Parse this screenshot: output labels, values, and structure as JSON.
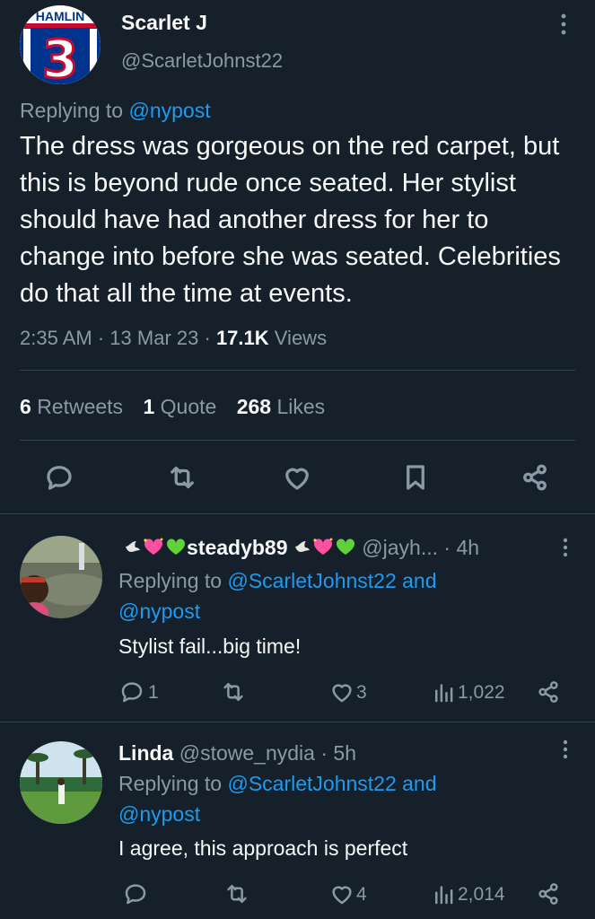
{
  "main_tweet": {
    "author_name": "Scarlet J",
    "author_handle": "@ScarletJohnst22",
    "jersey_name": "HAMLIN",
    "jersey_number": "3",
    "replying_to_prefix": "Replying to",
    "replying_to_handle": "@nypost",
    "text": "The dress was gorgeous on the red carpet, but this is beyond rude once seated. Her stylist should have had another dress for her to change into before she was seated. Celebrities do that all the time at events.",
    "time": "2:35 AM",
    "date": "13 Mar 23",
    "views_count": "17.1K",
    "views_label": "Views",
    "retweets_count": "6",
    "retweets_label": "Retweets",
    "quotes_count": "1",
    "quotes_label": "Quote",
    "likes_count": "268",
    "likes_label": "Likes",
    "actions": [
      "reply-icon",
      "retweet-icon",
      "like-icon",
      "bookmark-icon",
      "share-icon"
    ]
  },
  "replies": [
    {
      "display_name": "steadyb89",
      "handle": "@jayh...",
      "age": "4h",
      "replying_prefix": "Replying to",
      "replying_handles_line1": "@ScarletJohnst22 and",
      "replying_handles_line2": "@nypost",
      "text": "Stylist fail...big time!",
      "reply_count": "1",
      "retweet_count": "",
      "like_count": "3",
      "views": "1,022"
    },
    {
      "display_name": "Linda",
      "handle": "@stowe_nydia",
      "age": "5h",
      "replying_prefix": "Replying to",
      "replying_handles_line1": "@ScarletJohnst22 and",
      "replying_handles_line2": "@nypost",
      "text": "I agree, this approach is perfect",
      "reply_count": "",
      "retweet_count": "",
      "like_count": "4",
      "views": "2,014"
    }
  ],
  "colors": {
    "background": "#15202b",
    "text": "#f7f9f9",
    "muted": "#8b98a5",
    "link": "#1d9bf0",
    "divider": "#38444d",
    "jersey_blue": "#00338d",
    "jersey_red": "#c60c30"
  }
}
